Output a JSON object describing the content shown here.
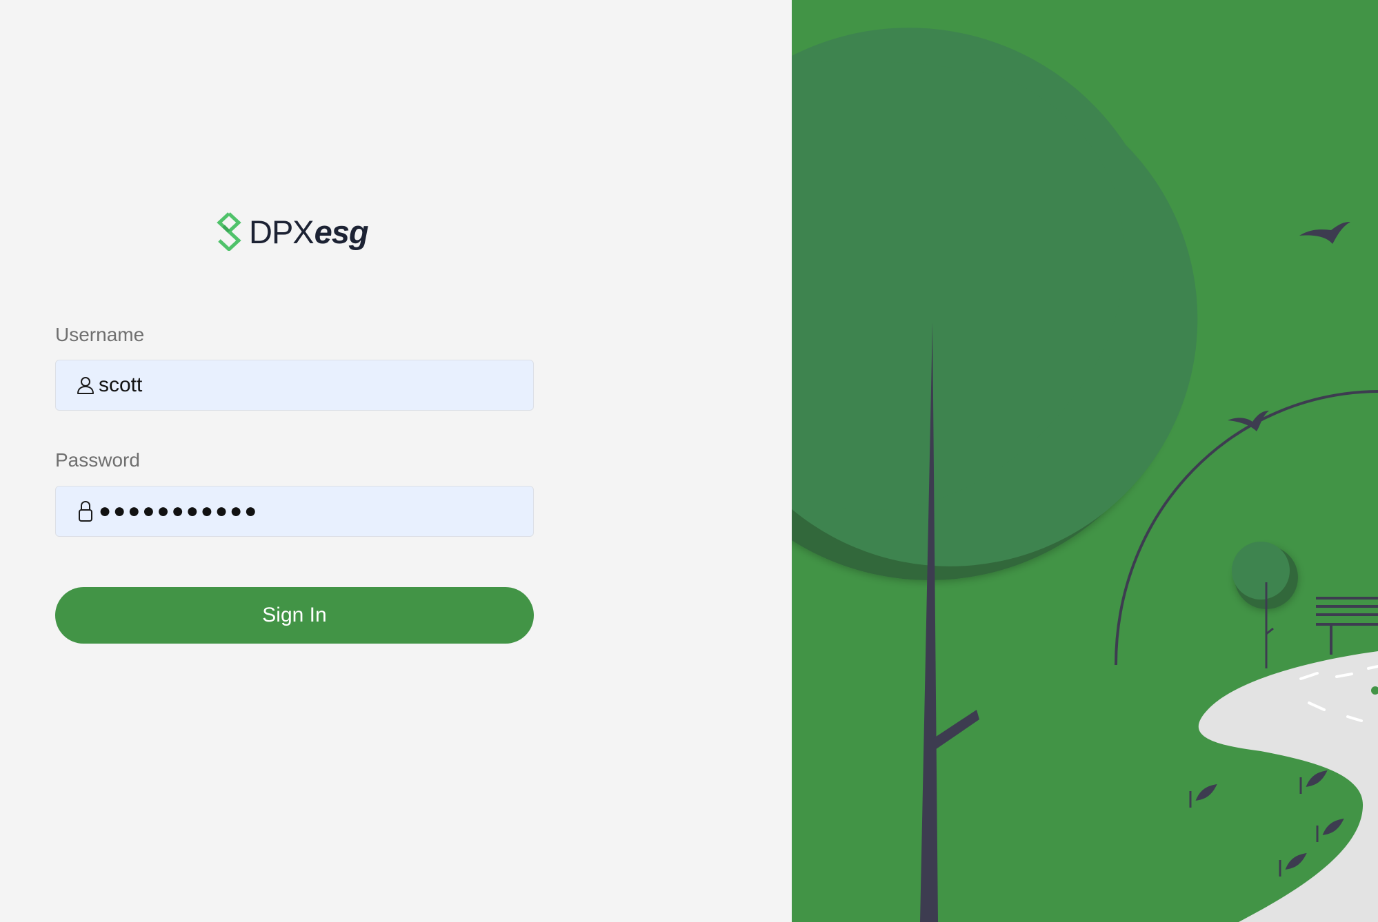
{
  "brand": {
    "name_main": "DPX",
    "name_suffix": "esg",
    "accent_color": "#429446",
    "logo_icon": "diamond-chevron-logo"
  },
  "login": {
    "username_label": "Username",
    "username_value": "scott",
    "username_icon": "user-icon",
    "password_label": "Password",
    "password_value": "●●●●●●●●●●●",
    "password_icon": "lock-icon",
    "signin_label": "Sign In"
  },
  "illustration": {
    "description_colors": {
      "background": "#429446",
      "tree_canopy_light": "#3e844f",
      "tree_canopy_dark": "#33683b",
      "trunk": "#3d3c50",
      "path": "#e3e3e3"
    }
  }
}
